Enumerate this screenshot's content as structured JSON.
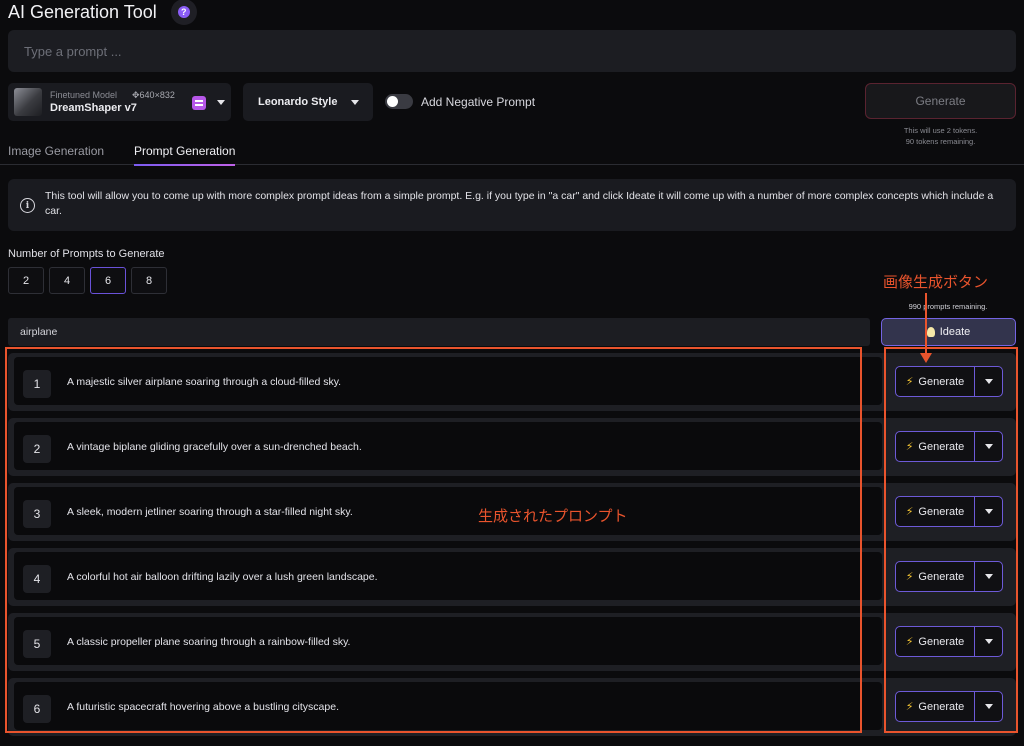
{
  "header": {
    "title": "AI Generation Tool",
    "help_icon": "?"
  },
  "prompt": {
    "placeholder": "Type a prompt ..."
  },
  "model": {
    "label": "Finetuned Model",
    "name": "DreamShaper v7",
    "dimensions": "640×832",
    "dims_icon": "move-icon"
  },
  "style": {
    "value": "Leonardo Style"
  },
  "negative_prompt": {
    "label": "Add Negative Prompt",
    "enabled": false
  },
  "generate": {
    "label": "Generate",
    "token_cost": "This will use 2 tokens.",
    "tokens_remaining": "90 tokens remaining."
  },
  "tabs": [
    {
      "label": "Image Generation",
      "active": false
    },
    {
      "label": "Prompt Generation",
      "active": true
    }
  ],
  "info": {
    "icon": "i",
    "text": "This tool will allow you to come up with more complex prompt ideas from a simple prompt. E.g. if you type in \"a car\" and click Ideate it will come up with a number of more complex concepts which include a car."
  },
  "num_prompts": {
    "label": "Number of Prompts to Generate",
    "options": [
      "2",
      "4",
      "6",
      "8"
    ],
    "selected": "6"
  },
  "ideate": {
    "input_value": "airplane",
    "button_label": "Ideate",
    "remaining": "990 prompts remaining."
  },
  "results": [
    {
      "num": "1",
      "text": "A majestic silver airplane soaring through a cloud-filled sky.",
      "button": "Generate"
    },
    {
      "num": "2",
      "text": "A vintage biplane gliding gracefully over a sun-drenched beach.",
      "button": "Generate"
    },
    {
      "num": "3",
      "text": "A sleek, modern jetliner soaring through a star-filled night sky.",
      "button": "Generate"
    },
    {
      "num": "4",
      "text": "A colorful hot air balloon drifting lazily over a lush green landscape.",
      "button": "Generate"
    },
    {
      "num": "5",
      "text": "A classic propeller plane soaring through a rainbow-filled sky.",
      "button": "Generate"
    },
    {
      "num": "6",
      "text": "A futuristic spacecraft hovering above a bustling cityscape.",
      "button": "Generate"
    }
  ],
  "annotations": {
    "generate_button_note": "画像生成ボタン",
    "generated_prompts_note": "生成されたプロンプト",
    "color": "#e9542d"
  },
  "colors": {
    "accent": "#6d5ad8",
    "background": "#0b0b0d",
    "panel": "#1e1f24"
  }
}
